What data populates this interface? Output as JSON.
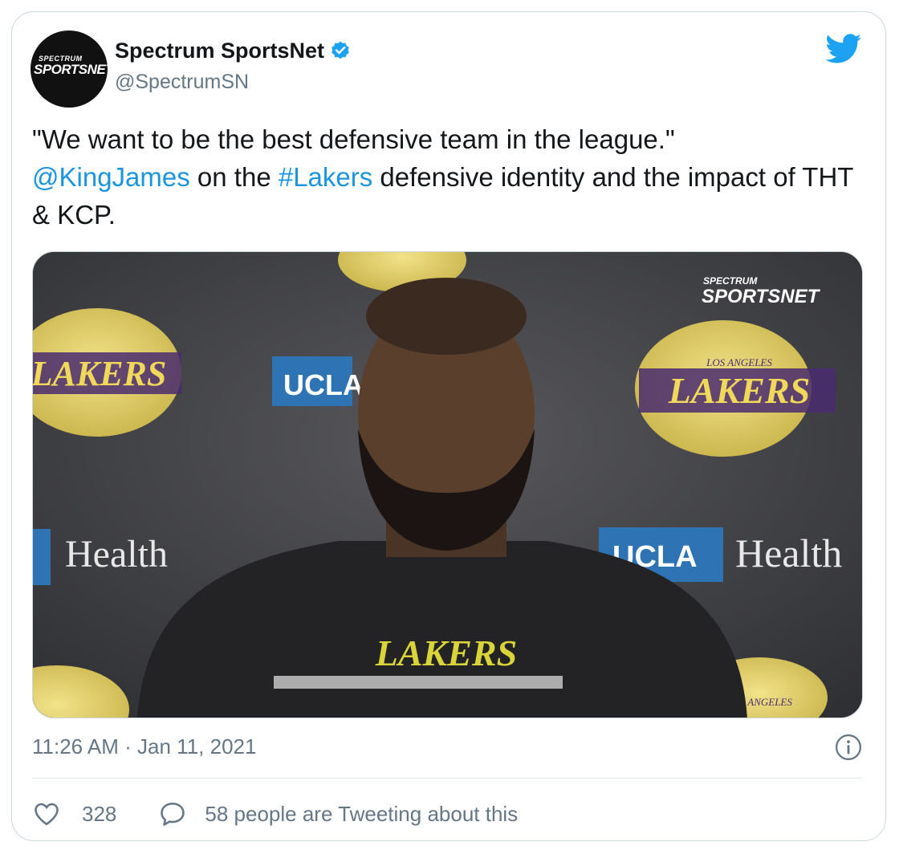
{
  "account": {
    "name": "Spectrum SportsNet",
    "handle": "@SpectrumSN",
    "avatar_logo_top": "SPECTRUM",
    "avatar_logo_bottom": "SPORTSNET"
  },
  "tweet": {
    "line1": "\"We want to be the best defensive team in the league.\"",
    "mention": "@KingJames",
    "mid_text": " on the ",
    "hashtag": "#Lakers",
    "end_text": " defensive identity and the impact of THT & KCP.",
    "timestamp": "11:26 AM · Jan 11, 2021"
  },
  "media": {
    "watermark_top": "SPECTRUM",
    "watermark_bottom": "SPORTSNET",
    "backdrop_labels": [
      "UCLA",
      "Health",
      "LAKERS",
      "LOS ANGELES"
    ],
    "shirt_text": "LAKERS"
  },
  "stats": {
    "likes": "328",
    "replies_label": "58 people are Tweeting about this"
  },
  "icons": [
    "verified-badge-icon",
    "twitter-bird-icon",
    "info-icon",
    "heart-icon",
    "reply-bubble-icon"
  ],
  "colors": {
    "link": "#1b95e0",
    "verified": "#1da1f2",
    "secondary_text": "#657786",
    "border": "#ccd6dd"
  }
}
